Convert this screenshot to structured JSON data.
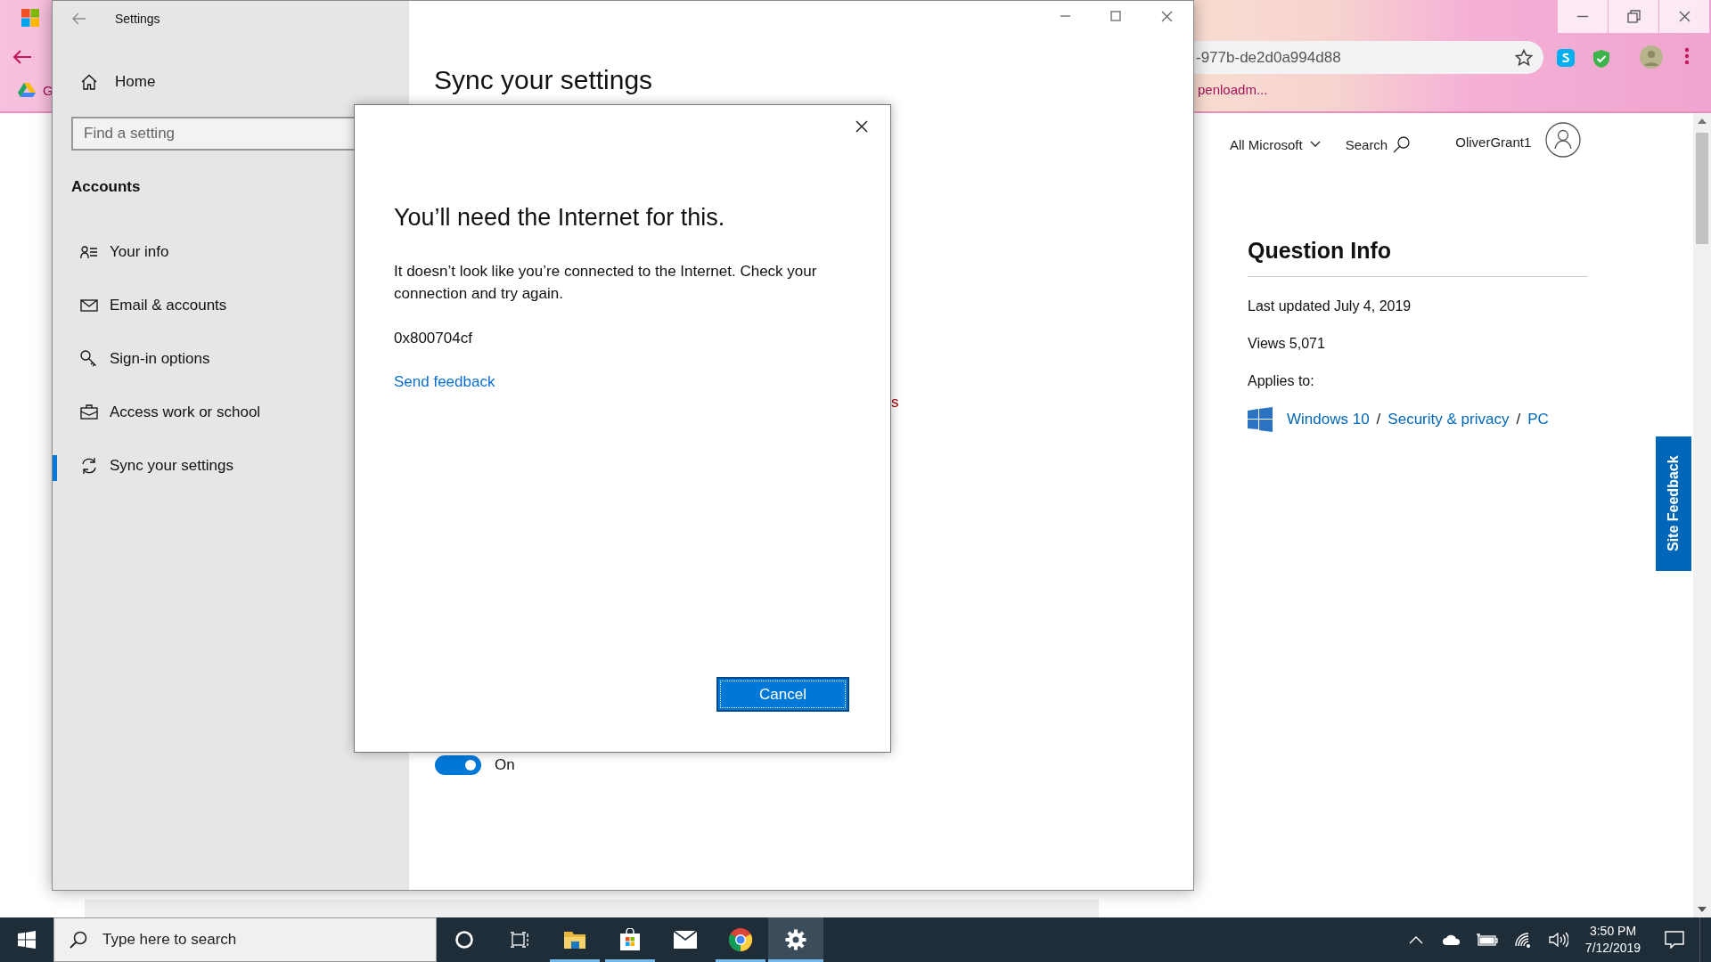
{
  "browser": {
    "address_fragment": "-977b-de2d0a994d88",
    "bookmarks": [
      {
        "label": "G"
      },
      {
        "label": "penloadm..."
      }
    ],
    "nav": {
      "all_microsoft": "All Microsoft",
      "search": "Search",
      "user": "OliverGrant1"
    },
    "question_info": {
      "title": "Question Info",
      "last_updated": "Last updated July 4, 2019",
      "views": "Views 5,071",
      "applies_to": "Applies to:",
      "links": [
        "Windows 10",
        "Security & privacy",
        "PC"
      ],
      "separators": [
        "/",
        "/"
      ]
    },
    "site_feedback": "Site Feedback"
  },
  "settings": {
    "title": "Settings",
    "home": "Home",
    "search": {
      "placeholder": "Find a setting"
    },
    "section": "Accounts",
    "items": [
      {
        "label": "Your info",
        "selected": false
      },
      {
        "label": "Email & accounts",
        "selected": false
      },
      {
        "label": "Sign-in options",
        "selected": false
      },
      {
        "label": "Access work or school",
        "selected": false
      },
      {
        "label": "Sync your settings",
        "selected": true
      }
    ],
    "page_title": "Sync your settings",
    "error_fragment": "s",
    "toggle": {
      "on": true,
      "label": "On"
    }
  },
  "dialog": {
    "title": "You’ll need the Internet for this.",
    "message": "It doesn’t look like you’re connected to the Internet. Check your connection and try again.",
    "code": "0x800704cf",
    "link": "Send feedback",
    "button": "Cancel"
  },
  "taskbar": {
    "search": {
      "placeholder": "Type here to search"
    },
    "apps": [
      {
        "kind": "cortana",
        "running": false,
        "active": false
      },
      {
        "kind": "taskview",
        "running": false,
        "active": false
      },
      {
        "kind": "explorer",
        "running": true,
        "active": false
      },
      {
        "kind": "store",
        "running": true,
        "active": false
      },
      {
        "kind": "mail",
        "running": false,
        "active": false
      },
      {
        "kind": "chrome",
        "running": true,
        "active": false
      },
      {
        "kind": "settings",
        "running": true,
        "active": true
      }
    ],
    "time": "3:50 PM",
    "date": "7/12/2019"
  }
}
